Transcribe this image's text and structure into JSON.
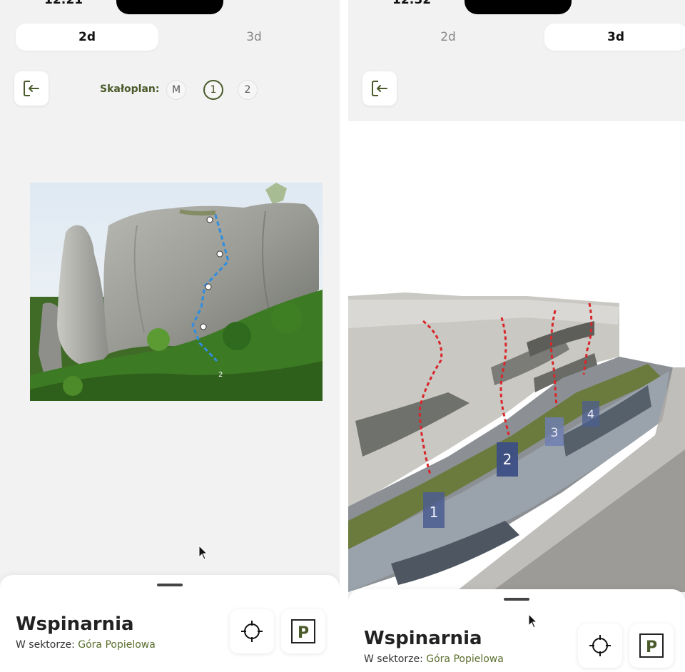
{
  "left": {
    "status_time": "12:21",
    "tabs": [
      {
        "label": "2d",
        "active": true
      },
      {
        "label": "3d",
        "active": false
      }
    ],
    "skalo_label": "Skałoplan:",
    "skalo_options": [
      {
        "label": "M"
      },
      {
        "label": "1",
        "selected": true
      },
      {
        "label": "2"
      }
    ],
    "photo_route_label": "2",
    "sheet": {
      "title": "Wspinarnia",
      "sector_prefix": "W sektorze:",
      "sector_name": "Góra Popielowa",
      "parking_label": "P"
    }
  },
  "right": {
    "status_time": "12:32",
    "tabs": [
      {
        "label": "2d",
        "active": false
      },
      {
        "label": "3d",
        "active": true
      }
    ],
    "route_markers": [
      "1",
      "2",
      "3",
      "4"
    ],
    "sheet": {
      "title": "Wspinarnia",
      "sector_prefix": "W sektorze:",
      "sector_name": "Góra Popielowa",
      "parking_label": "P"
    }
  },
  "colors": {
    "accent": "#4a5a2a",
    "route_2d": "#2f8ee0",
    "route_3d": "#d9262a",
    "marker": "#4b5d90"
  }
}
